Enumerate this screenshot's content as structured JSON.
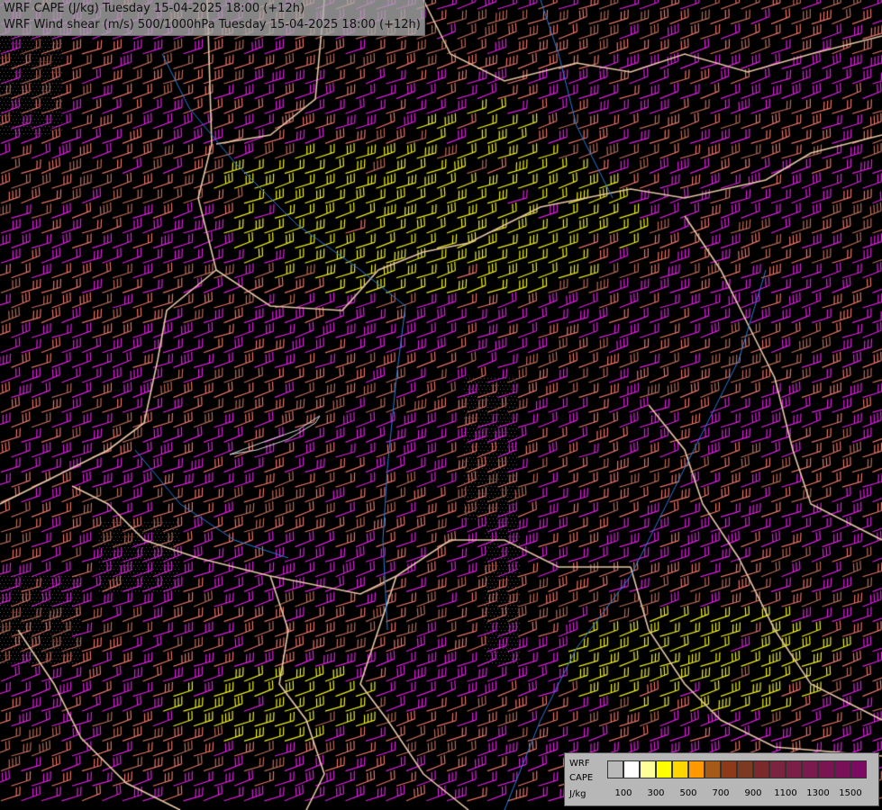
{
  "header": {
    "title_line1": "WRF CAPE (J/kg) Tuesday 15-04-2025 18:00 (+12h)",
    "title_line2": "WRF Wind shear (m/s) 500/1000hPa Tuesday 15-04-2025 18:00 (+12h)"
  },
  "legend": {
    "label_model": "WRF",
    "label_param": "CAPE",
    "label_unit": "J/kg",
    "colors": [
      "#b9b9b9",
      "#ffffff",
      "#ffff99",
      "#ffff00",
      "#ffd700",
      "#ff9900",
      "#a65a1a",
      "#8c3a1a",
      "#7d3a22",
      "#7a2a2a",
      "#7a2440",
      "#7a1f45",
      "#7a1a4d",
      "#7a1552",
      "#7a1058",
      "#7a0a62"
    ],
    "tick_labels": [
      "100",
      "300",
      "500",
      "700",
      "900",
      "1100",
      "1300",
      "1500"
    ]
  },
  "barb_colors": {
    "magenta": "#e020e0",
    "salmon": "#e8746a",
    "brown": "#b86a5a",
    "yellow": "#f0f020"
  },
  "border_color": "#e8c8a8",
  "river_color": "#2a7ad8"
}
